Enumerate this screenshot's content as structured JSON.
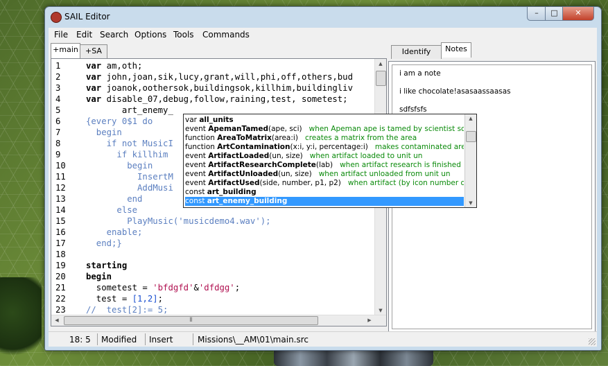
{
  "window": {
    "title": "SAIL Editor",
    "min": "–",
    "max": "□",
    "close": "✕"
  },
  "menu": [
    "File",
    "Edit",
    "Search",
    "Options",
    "Tools",
    "Commands"
  ],
  "editor_tabs": [
    "+main",
    "+SA"
  ],
  "right_tabs": [
    "Identify (Lite)",
    "Notes"
  ],
  "line_numbers": [
    "1",
    "2",
    "3",
    "4",
    "5",
    "6",
    "7",
    "8",
    "9",
    "10",
    "11",
    "12",
    "13",
    "14",
    "15",
    "16",
    "17",
    "18",
    "19",
    "20",
    "21",
    "22",
    "23"
  ],
  "code": {
    "l1": [
      "var",
      " am,oth;"
    ],
    "l2": [
      "var",
      " john,joan,sik,lucy,grant,will,phi,off,others,bud"
    ],
    "l3": [
      "var",
      " joanok,oothersok,buildingsok,killhim,buildingliv"
    ],
    "l4": [
      "var",
      " disable_07,debug,follow,raining,test, sometest;"
    ],
    "l5": "       art_enemy_",
    "l6": "{every 0$1 do",
    "l7": "  begin",
    "l8": "    if not MusicI",
    "l9": "      if killhim",
    "l10": "        begin",
    "l11": "          InsertM",
    "l12": "          AddMusi",
    "l13": "        end",
    "l14": "      else",
    "l15_a": "        PlayMusic(",
    "l15_b": "'musicdemo4.wav'",
    "l15_c": ");",
    "l16": "    enable;",
    "l17": "  end;}",
    "l19": "starting",
    "l20": "begin",
    "l21_a": "  sometest = ",
    "l21_b": "'bfdgfd'",
    "l21_c": "&",
    "l21_d": "'dfdgg'",
    "l21_e": ";",
    "l22_a": "  test = ",
    "l22_b": "[1,2]",
    "l22_c": ";",
    "l23": "//  test[2]:= 5;"
  },
  "autocomplete": [
    {
      "kind": "var",
      "name": "all_units",
      "sig": "",
      "desc": ""
    },
    {
      "kind": "event",
      "name": "ApemanTamed",
      "sig": "(ape, sci)",
      "desc": "when Apeman ape is tamed by scientist sci"
    },
    {
      "kind": "function",
      "name": "AreaToMatrix",
      "sig": "(area:i)",
      "desc": "creates a matrix from the area"
    },
    {
      "kind": "function",
      "name": "ArtContamination",
      "sig": "(x:i, y:i, percentage:i)",
      "desc": "makes contaminated area (perce"
    },
    {
      "kind": "event",
      "name": "ArtifactLoaded",
      "sig": "(un, size)",
      "desc": "when artifact loaded to unit un"
    },
    {
      "kind": "event",
      "name": "ArtifactResearchComplete",
      "sig": "(lab)",
      "desc": "when artifact research is finished in lab"
    },
    {
      "kind": "event",
      "name": "ArtifactUnloaded",
      "sig": "(un, size)",
      "desc": "when artifact unloaded from unit un"
    },
    {
      "kind": "event",
      "name": "ArtifactUsed",
      "sig": "(side, number, p1, p2)",
      "desc": "when artifact (by icon number of side) us"
    },
    {
      "kind": "const",
      "name": "art_building",
      "sig": "",
      "desc": ""
    },
    {
      "kind": "const",
      "name": "art_enemy_building",
      "sig": "",
      "desc": ""
    }
  ],
  "notes": [
    "i am a note",
    "i like chocolate!asasaassaasas",
    "sdfsfsfs"
  ],
  "status": {
    "position": "18:  5",
    "modified": "Modified",
    "mode": "Insert",
    "file": "Missions\\__AM\\01\\main.src"
  },
  "scroll_glyphs": {
    "up": "▲",
    "down": "▼",
    "left": "◀",
    "right": "▶",
    "grip": "Ⅱ"
  }
}
